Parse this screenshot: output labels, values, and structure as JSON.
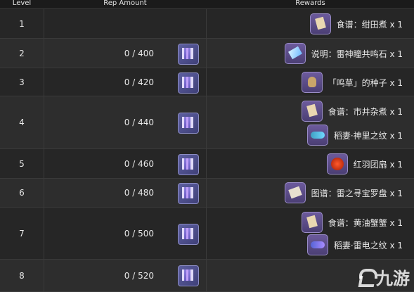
{
  "header": {
    "level": "Level",
    "rep_amount": "Rep Amount",
    "rewards": "Rewards"
  },
  "rows": [
    {
      "level": "1",
      "rep": "",
      "rewards": [
        {
          "icon": "recipe-icon",
          "text": "食谱：绀田煮 x 1"
        }
      ]
    },
    {
      "level": "2",
      "rep": "0 / 400",
      "rewards": [
        {
          "icon": "crystal-icon",
          "text": "说明：雷神瞳共鸣石 x 1"
        }
      ]
    },
    {
      "level": "3",
      "rep": "0 / 420",
      "rewards": [
        {
          "icon": "seed-icon",
          "text": "「鸣草」的种子 x 1"
        }
      ]
    },
    {
      "level": "4",
      "rep": "0 / 440",
      "rewards": [
        {
          "icon": "recipe-icon",
          "text": "食谱：市井杂煮 x 1"
        },
        {
          "icon": "nameplate-icon",
          "text": "稻妻·神里之纹 x 1"
        }
      ]
    },
    {
      "level": "5",
      "rep": "0 / 460",
      "rewards": [
        {
          "icon": "fan-icon",
          "text": "红羽团扇 x 1"
        }
      ]
    },
    {
      "level": "6",
      "rep": "0 / 480",
      "rewards": [
        {
          "icon": "blueprint-icon",
          "text": "图谱：雷之寻宝罗盘 x 1"
        }
      ]
    },
    {
      "level": "7",
      "rep": "0 / 500",
      "rewards": [
        {
          "icon": "recipe-icon",
          "text": "食谱：黄油蟹蟹 x 1"
        },
        {
          "icon": "nameplate-icon",
          "text": "稻妻·雷电之纹 x 1"
        }
      ]
    },
    {
      "level": "8",
      "rep": "0 / 520",
      "rewards": []
    }
  ],
  "watermark": {
    "logo_icon": "jiuyou-logo-icon",
    "text": "九游"
  },
  "colors": {
    "background": "#202020",
    "row_odd": "#262626",
    "row_even": "#2d2d2d",
    "border": "#3a3a3a",
    "text": "#e8e8e8"
  }
}
